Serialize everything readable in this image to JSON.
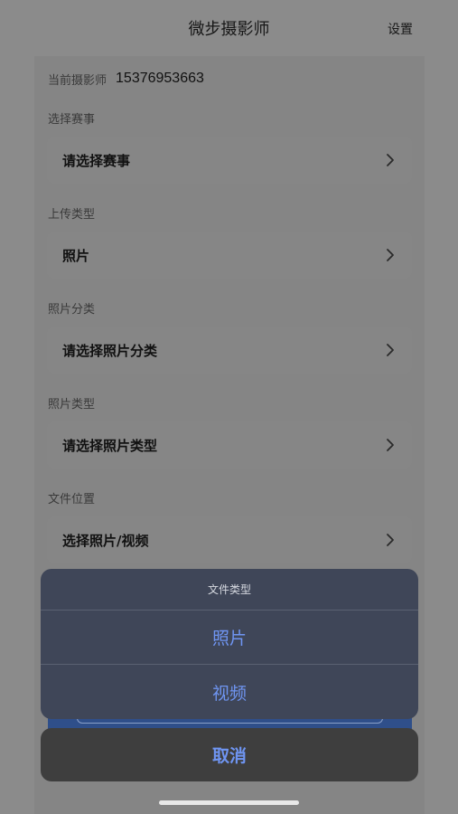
{
  "nav": {
    "title": "微步摄影师",
    "settings_label": "设置"
  },
  "photographer": {
    "label": "当前摄影师",
    "value": "15376953663"
  },
  "sections": [
    {
      "label": "选择赛事",
      "value": "请选择赛事"
    },
    {
      "label": "上传类型",
      "value": "照片"
    },
    {
      "label": "照片分类",
      "value": "请选择照片分类"
    },
    {
      "label": "照片类型",
      "value": "请选择照片类型"
    },
    {
      "label": "文件位置",
      "value": "选择照片/视频"
    }
  ],
  "icons": {
    "row_chevron": "chevron-right-icon"
  },
  "action_sheet": {
    "title": "文件类型",
    "options": [
      "照片",
      "视频"
    ],
    "cancel_label": "取消"
  },
  "colors": {
    "accent": "#6f95f2",
    "sheet_background": "#3f4658",
    "overlay": "#8b8b8b"
  }
}
